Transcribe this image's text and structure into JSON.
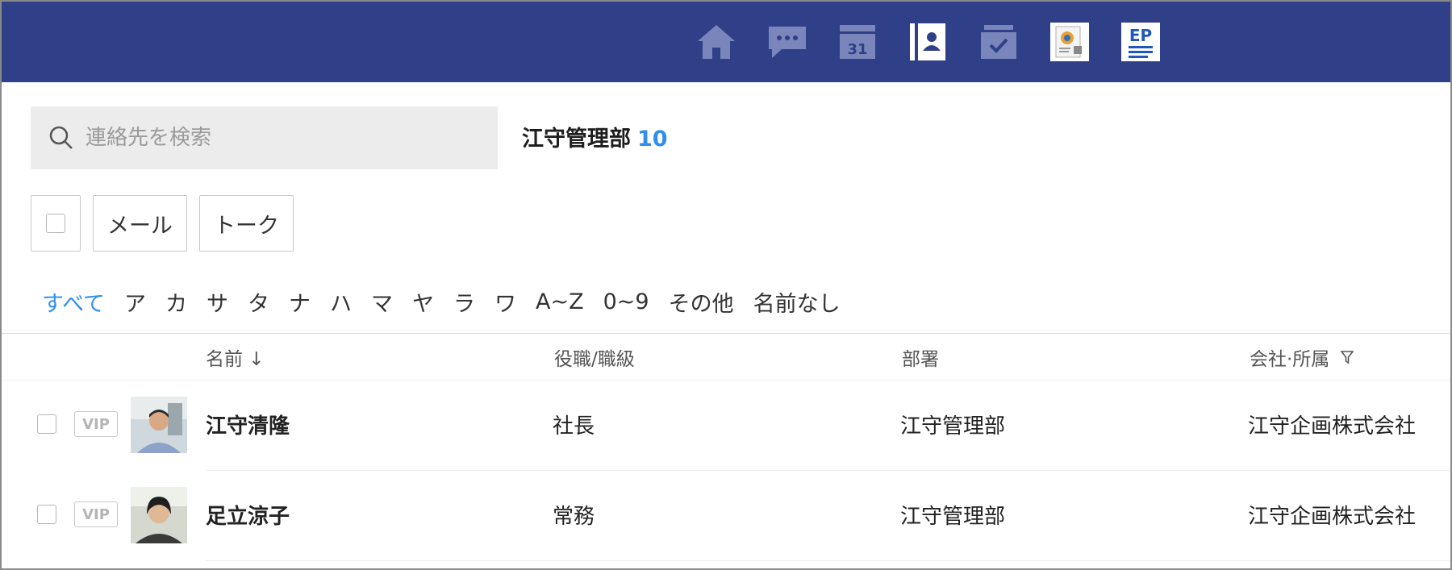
{
  "header": {
    "nav_icons": [
      "home-icon",
      "chat-icon",
      "calendar-icon",
      "contacts-icon",
      "task-icon",
      "document-app-icon",
      "smart-portal-icon"
    ],
    "calendar_day": "31",
    "accent_color": "#2f4088"
  },
  "search": {
    "placeholder": "連絡先を検索"
  },
  "group": {
    "name": "江守管理部",
    "count": "10"
  },
  "actions": {
    "mail_label": "メール",
    "talk_label": "トーク"
  },
  "index_filter": [
    "すべて",
    "ア",
    "カ",
    "サ",
    "タ",
    "ナ",
    "ハ",
    "マ",
    "ヤ",
    "ラ",
    "ワ",
    "A~Z",
    "0~9",
    "その他",
    "名前なし"
  ],
  "table": {
    "columns": {
      "name": "名前 ↓",
      "title": "役職/職級",
      "department": "部署",
      "company": "会社·所属"
    },
    "vip_label": "VIP",
    "rows": [
      {
        "name": "江守清隆",
        "title": "社長",
        "department": "江守管理部",
        "company": "江守企画株式会社"
      },
      {
        "name": "足立涼子",
        "title": "常務",
        "department": "江守管理部",
        "company": "江守企画株式会社"
      }
    ]
  }
}
